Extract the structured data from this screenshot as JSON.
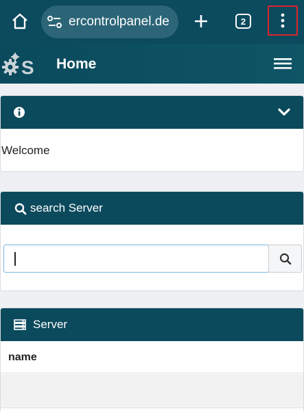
{
  "browser": {
    "url_text": "ercontrolpanel.de",
    "tab_count": "2"
  },
  "app": {
    "logo_letter": "S",
    "title": "Home"
  },
  "info_panel": {
    "welcome_text": "Welcome"
  },
  "search_panel": {
    "title": "search Server",
    "input_value": ""
  },
  "server_panel": {
    "title": "Server",
    "columns": [
      "name"
    ]
  },
  "colors": {
    "browser_bar": "#0c4a5e",
    "panel_header": "#0b4a5c",
    "highlight_border": "#e0242a",
    "input_focus": "#7ab3de"
  },
  "icons": [
    "home-icon",
    "site-settings-icon",
    "plus-icon",
    "tab-switcher-icon",
    "more-vert-icon",
    "gear-logo-icon",
    "hamburger-icon",
    "info-icon",
    "chevron-down-icon",
    "search-icon",
    "server-icon"
  ]
}
